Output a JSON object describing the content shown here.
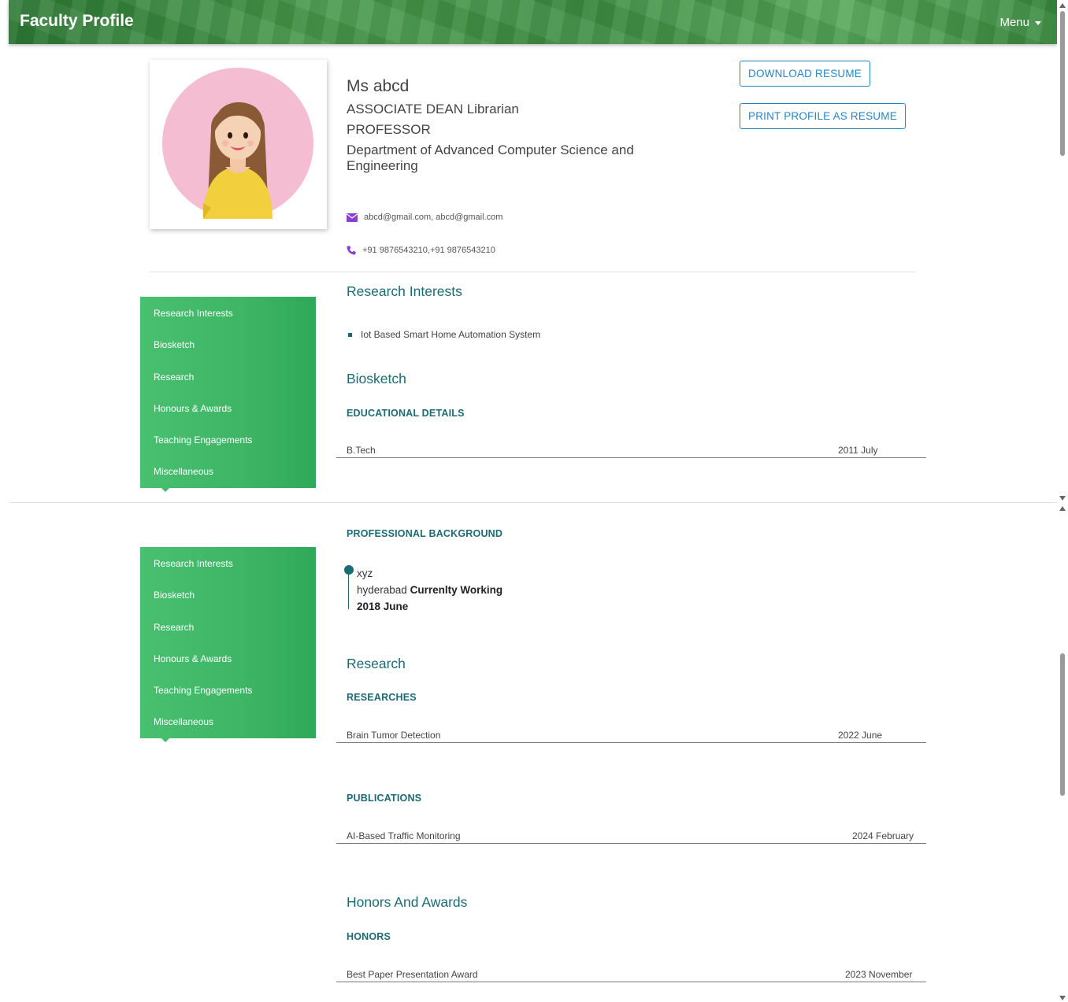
{
  "header": {
    "brand": "Faculty Profile",
    "menu_label": "Menu"
  },
  "profile": {
    "name": "Ms abcd",
    "designation": "ASSOCIATE DEAN Librarian",
    "position": "PROFESSOR",
    "department": "Department of Advanced Computer Science and Engineering",
    "email": "abcd@gmail.com, abcd@gmail.com",
    "phone": "+91 9876543210,+91 9876543210"
  },
  "actions": {
    "download_resume": "DOWNLOAD RESUME",
    "print_profile": "PRINT PROFILE AS RESUME"
  },
  "sidenav": {
    "items": [
      "Research Interests",
      "Biosketch",
      "Research",
      "Honours & Awards",
      "Teaching Engagements",
      "Miscellaneous"
    ]
  },
  "research_interests": {
    "title": "Research Interests",
    "items": [
      "Iot Based Smart Home Automation System"
    ]
  },
  "biosketch": {
    "title": "Biosketch",
    "education_heading": "EDUCATIONAL DETAILS",
    "education": [
      {
        "degree": "B.Tech",
        "date": "2011 July"
      }
    ],
    "professional_heading": "PROFESSIONAL BACKGROUND",
    "professional": {
      "org": "xyz",
      "location": "hyderabad",
      "status": "Currenlty Working",
      "since": "2018 June"
    }
  },
  "research": {
    "title": "Research",
    "researches_heading": "RESEARCHES",
    "researches": [
      {
        "title": "Brain Tumor Detection",
        "date": "2022 June"
      }
    ],
    "publications_heading": "PUBLICATIONS",
    "publications": [
      {
        "title": "AI-Based Traffic Monitoring",
        "date": "2024 February"
      }
    ]
  },
  "honors": {
    "title": "Honors And Awards",
    "honors_heading": "HONORS",
    "items": [
      {
        "title": "Best Paper Presentation Award",
        "date": "2023 November"
      }
    ]
  },
  "colors": {
    "accent_teal": "#1c6b73",
    "button_blue": "#2486c9",
    "nav_green": "#3db565",
    "header_green": "#3f8e45"
  },
  "icons": {
    "email": "envelope-icon",
    "phone": "phone-icon",
    "menu_caret": "caret-down-icon"
  }
}
